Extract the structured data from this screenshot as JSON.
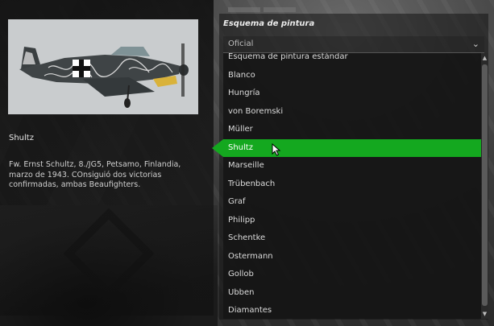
{
  "skin_panel": {
    "title": "Shultz",
    "description": "Fw. Ernst Schultz, 8./JG5, Petsamo, Finlandia, marzo de 1943. COnsiguió dos victorias confirmadas, ambas Beaufighters."
  },
  "paint_scheme": {
    "label": "Esquema de pintura",
    "dropdown_value": "Oficial",
    "items": [
      "Esquema de pintura estándar",
      "Blanco",
      "Hungría",
      "von Boremski",
      "Müller",
      "Shultz",
      "Marseille",
      "Trübenbach",
      "Graf",
      "Philipp",
      "Schentke",
      "Ostermann",
      "Gollob",
      "Ubben",
      "Diamantes"
    ],
    "selected_index": 5
  },
  "colors": {
    "accent_green": "#14a81f",
    "panel_bg": "#161616",
    "preview_bg": "#c9ccce"
  },
  "icons": {
    "dropdown": "chevron-down-icon",
    "scroll_up": "arrow-up-icon",
    "scroll_down": "arrow-down-icon",
    "pointer": "mouse-cursor-icon"
  }
}
